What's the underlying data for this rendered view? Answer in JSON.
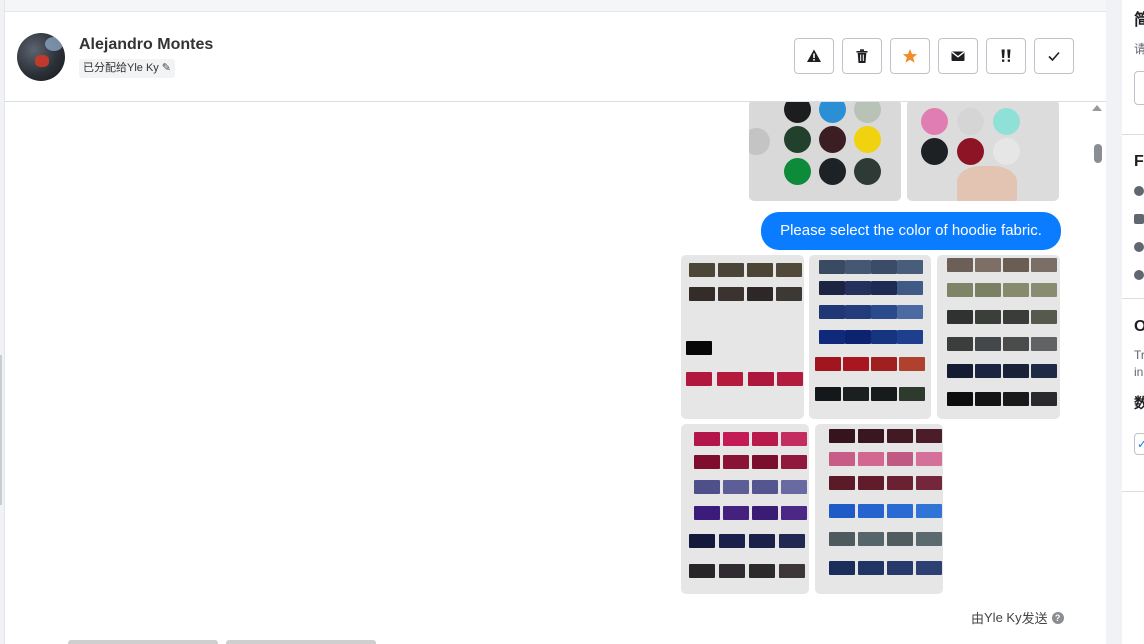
{
  "contact": {
    "name": "Alejandro Montes",
    "assigned_label": "已分配给Yle Ky"
  },
  "toolbar": {
    "buttons": [
      {
        "name": "warning-button",
        "icon": "warning-icon"
      },
      {
        "name": "delete-button",
        "icon": "trash-icon"
      },
      {
        "name": "star-button",
        "icon": "star-icon",
        "color": "#f28c28"
      },
      {
        "name": "email-button",
        "icon": "envelope-icon"
      },
      {
        "name": "priority-button",
        "icon": "double-exclamation-icon"
      },
      {
        "name": "done-button",
        "icon": "check-icon"
      }
    ]
  },
  "conversation": {
    "message_text": "Please select the color of hoodie fabric.",
    "sent_by_prefix": "由",
    "sent_by_name": "Yle Ky",
    "sent_by_suffix": "发送",
    "help_glyph": "?"
  },
  "right_panel": {
    "partial_texts": {
      "heading_top": "简",
      "hint": "请",
      "section_f": "F",
      "section_o": "O",
      "line_tr": "Tr",
      "line_in": "in",
      "data_label": "数"
    }
  },
  "colors": {
    "accent": "#0a7cff",
    "star": "#f28c28",
    "bubble_text": "#ffffff"
  }
}
